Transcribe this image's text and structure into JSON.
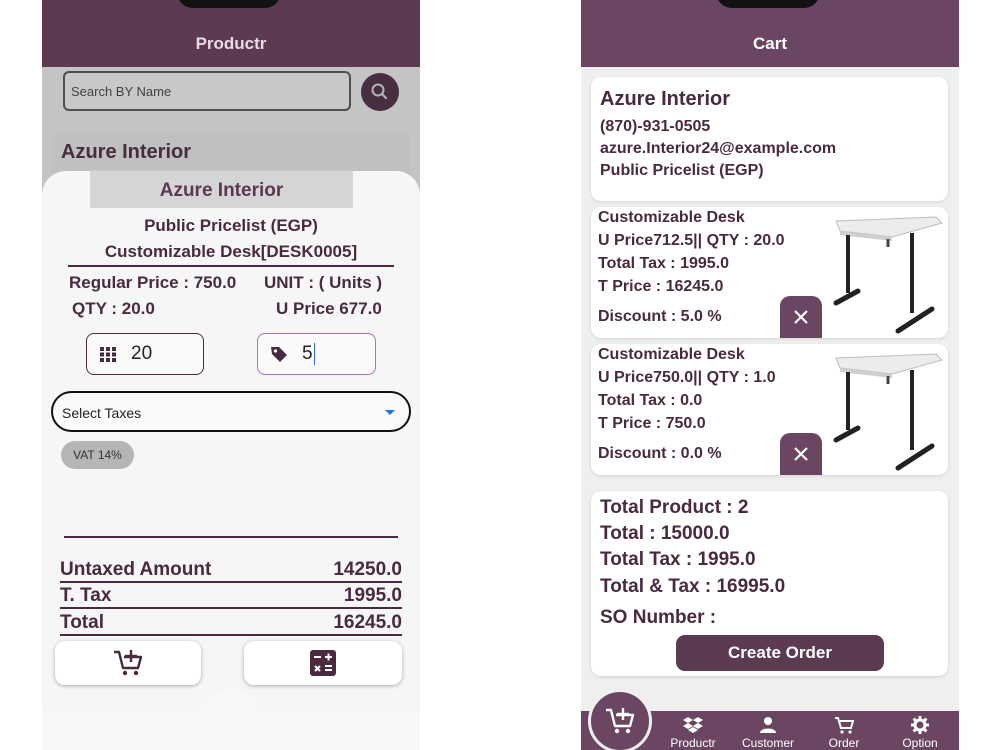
{
  "left": {
    "header_title": "Productr",
    "search": {
      "placeholder": "Search BY Name"
    },
    "background_card_title": "Azure Interior",
    "dialog": {
      "customer": "Azure Interior",
      "pricelist": "Public Pricelist (EGP)",
      "product": "Customizable Desk[DESK0005]",
      "regular_price": "Regular Price : 750.0",
      "unit": "UNIT : ( Units )",
      "qty": "QTY : 20.0",
      "u_price": "U Price 677.0",
      "qty_input": "20",
      "discount_input": "5",
      "select_taxes": "Select Taxes",
      "tax_chip": "VAT 14%",
      "summary": [
        {
          "label": "Untaxed Amount",
          "value": "14250.0"
        },
        {
          "label": "T. Tax",
          "value": "1995.0"
        },
        {
          "label": "Total",
          "value": "16245.0"
        }
      ]
    }
  },
  "right": {
    "header_title": "Cart",
    "customer": {
      "name": "Azure Interior",
      "phone": "(870)-931-0505",
      "email": "azure.Interior24@example.com",
      "pricelist": "Public Pricelist (EGP)"
    },
    "lines": [
      {
        "name": "Customizable Desk",
        "price_qty": "U Price712.5|| QTY : 20.0",
        "tax": "Total Tax : 1995.0",
        "t_price": "T Price : 16245.0",
        "discount": "Discount : 5.0 %"
      },
      {
        "name": "Customizable Desk",
        "price_qty": "U Price750.0|| QTY : 1.0",
        "tax": "Total Tax : 0.0",
        "t_price": "T Price : 750.0",
        "discount": "Discount : 0.0 %"
      }
    ],
    "summary": {
      "total_product": "Total Product : 2",
      "total": "Total : 15000.0",
      "total_tax": "Total Tax : 1995.0",
      "total_and_tax": "Total & Tax : 16995.0",
      "so_number": "SO Number :"
    },
    "create_order": "Create Order",
    "nav": {
      "productr": "Productr",
      "customer": "Customer",
      "order": "Order",
      "option": "Option"
    }
  },
  "colors": {
    "brand": "#5b3a52",
    "brand_light": "#6b4663",
    "accent_caret": "#1e73e8"
  }
}
